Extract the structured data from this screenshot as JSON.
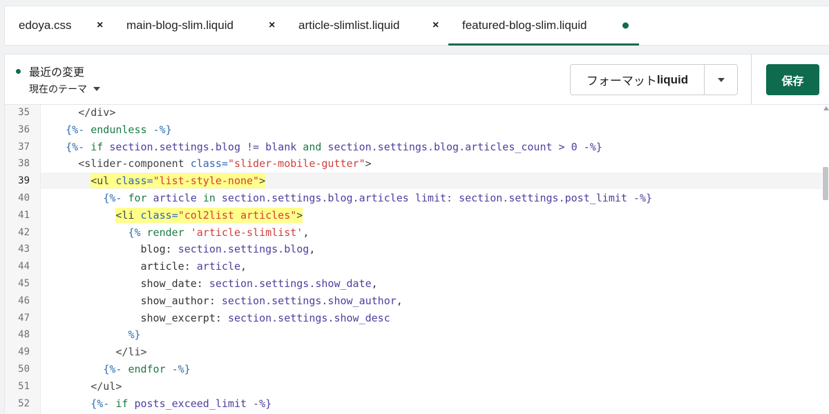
{
  "tabs": [
    {
      "label": "edoya.css",
      "close": "×",
      "active": false
    },
    {
      "label": "main-blog-slim.liquid",
      "close": "×",
      "active": false
    },
    {
      "label": "article-slimlist.liquid",
      "close": "×",
      "active": false
    },
    {
      "label": "featured-blog-slim.liquid",
      "modified": true,
      "active": true
    }
  ],
  "header": {
    "recent_changes": "最近の変更",
    "theme_select": "現在のテーマ",
    "format_label_prefix": "フォーマット",
    "format_label_bold": "liquid",
    "save_label": "保存"
  },
  "editor": {
    "current_line": 39,
    "line_numbers": [
      "35",
      "36",
      "37",
      "38",
      "39",
      "40",
      "41",
      "42",
      "43",
      "44",
      "45",
      "46",
      "47",
      "48",
      "49",
      "50",
      "51",
      "52"
    ],
    "lines": [
      {
        "num": "35",
        "indent": "      ",
        "tokens": [
          {
            "t": "</div>",
            "c": "tag"
          }
        ]
      },
      {
        "num": "36",
        "indent": "    ",
        "tokens": [
          {
            "t": "{%- ",
            "c": "liquid"
          },
          {
            "t": "endunless",
            "c": "kw"
          },
          {
            "t": " -%}",
            "c": "liquid"
          }
        ]
      },
      {
        "num": "37",
        "indent": "    ",
        "tokens": [
          {
            "t": "{%- ",
            "c": "liquid"
          },
          {
            "t": "if",
            "c": "kw"
          },
          {
            "t": " section.settings.blog != blank ",
            "c": "var"
          },
          {
            "t": "and",
            "c": "kw"
          },
          {
            "t": " section.settings.blog.articles_count > 0 -%}",
            "c": "var"
          }
        ]
      },
      {
        "num": "38",
        "indent": "      ",
        "tokens": [
          {
            "t": "<slider-component ",
            "c": "tag"
          },
          {
            "t": "class=",
            "c": "attr"
          },
          {
            "t": "\"slider-mobile-gutter\"",
            "c": "str"
          },
          {
            "t": ">",
            "c": "tag"
          }
        ]
      },
      {
        "num": "39",
        "indent": "        ",
        "highlight": true,
        "tokens": [
          {
            "t": "<ul ",
            "c": "tag"
          },
          {
            "t": "class=",
            "c": "attr"
          },
          {
            "t": "\"list-style-none\"",
            "c": "str"
          },
          {
            "t": ">",
            "c": "tag"
          }
        ]
      },
      {
        "num": "40",
        "indent": "          ",
        "tokens": [
          {
            "t": "{%- ",
            "c": "liquid"
          },
          {
            "t": "for",
            "c": "kw"
          },
          {
            "t": " article ",
            "c": "var"
          },
          {
            "t": "in",
            "c": "kw"
          },
          {
            "t": " section.settings.blog.articles limit: section.settings.post_limit -%}",
            "c": "var"
          }
        ]
      },
      {
        "num": "41",
        "indent": "            ",
        "highlight": true,
        "tokens": [
          {
            "t": "<li ",
            "c": "tag"
          },
          {
            "t": "class=",
            "c": "attr"
          },
          {
            "t": "\"col2list articles\"",
            "c": "str"
          },
          {
            "t": ">",
            "c": "tag"
          }
        ]
      },
      {
        "num": "42",
        "indent": "              ",
        "tokens": [
          {
            "t": "{% ",
            "c": "liquid"
          },
          {
            "t": "render",
            "c": "kw"
          },
          {
            "t": " ",
            "c": "plain"
          },
          {
            "t": "'article-slimlist'",
            "c": "str"
          },
          {
            "t": ",",
            "c": "plain"
          }
        ]
      },
      {
        "num": "43",
        "indent": "                ",
        "tokens": [
          {
            "t": "blog: ",
            "c": "plain"
          },
          {
            "t": "section.settings.blog",
            "c": "var"
          },
          {
            "t": ",",
            "c": "plain"
          }
        ]
      },
      {
        "num": "44",
        "indent": "                ",
        "tokens": [
          {
            "t": "article: ",
            "c": "plain"
          },
          {
            "t": "article",
            "c": "var"
          },
          {
            "t": ",",
            "c": "plain"
          }
        ]
      },
      {
        "num": "45",
        "indent": "                ",
        "tokens": [
          {
            "t": "show_date: ",
            "c": "plain"
          },
          {
            "t": "section.settings.show_date",
            "c": "var"
          },
          {
            "t": ",",
            "c": "plain"
          }
        ]
      },
      {
        "num": "46",
        "indent": "                ",
        "tokens": [
          {
            "t": "show_author: ",
            "c": "plain"
          },
          {
            "t": "section.settings.show_author",
            "c": "var"
          },
          {
            "t": ",",
            "c": "plain"
          }
        ]
      },
      {
        "num": "47",
        "indent": "                ",
        "tokens": [
          {
            "t": "show_excerpt: ",
            "c": "plain"
          },
          {
            "t": "section.settings.show_desc",
            "c": "var"
          }
        ]
      },
      {
        "num": "48",
        "indent": "              ",
        "tokens": [
          {
            "t": "%}",
            "c": "liquid"
          }
        ]
      },
      {
        "num": "49",
        "indent": "            ",
        "tokens": [
          {
            "t": "</li>",
            "c": "tag"
          }
        ]
      },
      {
        "num": "50",
        "indent": "          ",
        "tokens": [
          {
            "t": "{%- ",
            "c": "liquid"
          },
          {
            "t": "endfor",
            "c": "kw"
          },
          {
            "t": " -%}",
            "c": "liquid"
          }
        ]
      },
      {
        "num": "51",
        "indent": "        ",
        "tokens": [
          {
            "t": "</ul>",
            "c": "tag"
          }
        ]
      },
      {
        "num": "52",
        "indent": "        ",
        "tokens": [
          {
            "t": "{%- ",
            "c": "liquid"
          },
          {
            "t": "if",
            "c": "kw"
          },
          {
            "t": " posts_exceed_limit -%}",
            "c": "var"
          }
        ]
      }
    ]
  },
  "colors": {
    "accent": "#0e6b4d",
    "highlight": "#ffff8a"
  }
}
